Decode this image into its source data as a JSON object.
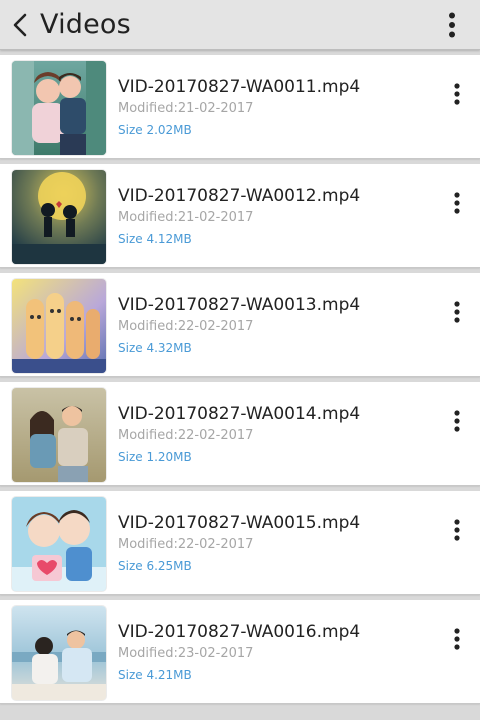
{
  "header": {
    "title": "Videos"
  },
  "videos": [
    {
      "name": "VID-20170827-WA0011.mp4",
      "modified": "Modified:21-02-2017",
      "size": "Size 2.02MB"
    },
    {
      "name": "VID-20170827-WA0012.mp4",
      "modified": "Modified:21-02-2017",
      "size": "Size 4.12MB"
    },
    {
      "name": "VID-20170827-WA0013.mp4",
      "modified": "Modified:22-02-2017",
      "size": "Size 4.32MB"
    },
    {
      "name": "VID-20170827-WA0014.mp4",
      "modified": "Modified:22-02-2017",
      "size": "Size 1.20MB"
    },
    {
      "name": "VID-20170827-WA0015.mp4",
      "modified": "Modified:22-02-2017",
      "size": "Size 6.25MB"
    },
    {
      "name": "VID-20170827-WA0016.mp4",
      "modified": "Modified:23-02-2017",
      "size": "Size 4.21MB"
    }
  ],
  "icons": {
    "back": "chevron-left-icon",
    "overflow": "more-vert-icon",
    "item_menu": "more-vert-icon"
  },
  "colors": {
    "topbar": "#e4e4e4",
    "size_text": "#4a9ad6",
    "modified_text": "#a6a6a6"
  }
}
